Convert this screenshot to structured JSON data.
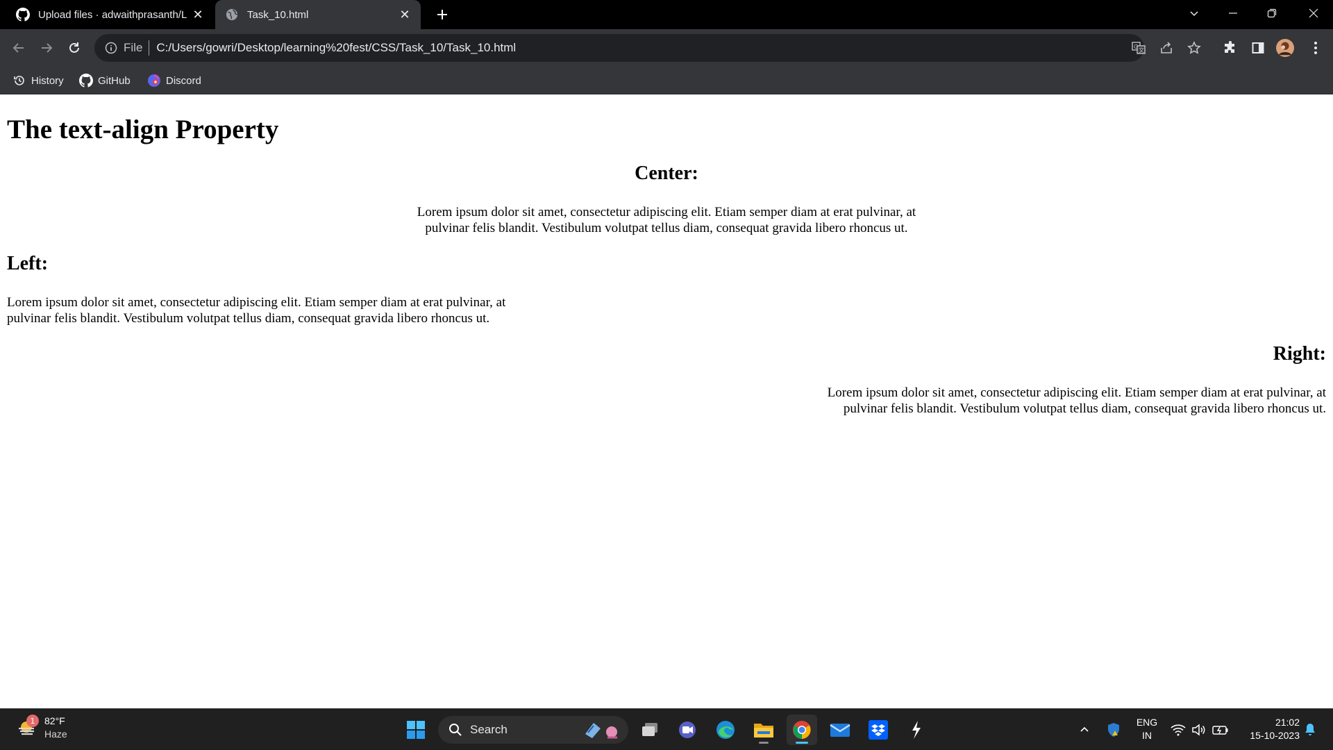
{
  "browser": {
    "tabs": [
      {
        "title": "Upload files · adwaithprasanth/L",
        "favicon": "github-icon",
        "active": false
      },
      {
        "title": "Task_10.html",
        "favicon": "globe-icon",
        "active": true
      }
    ],
    "address_bar": {
      "scheme_label": "File",
      "url": "C:/Users/gowri/Desktop/learning%20fest/CSS/Task_10/Task_10.html"
    },
    "bookmarks": [
      {
        "label": "History",
        "icon": "history-icon"
      },
      {
        "label": "GitHub",
        "icon": "github-icon"
      },
      {
        "label": "Discord",
        "icon": "discord-icon"
      }
    ]
  },
  "page": {
    "heading": "The text-align Property",
    "sections": {
      "center": {
        "title": "Center:",
        "text": "Lorem ipsum dolor sit amet, consectetur adipiscing elit. Etiam semper diam at erat pulvinar, at pulvinar felis blandit. Vestibulum volutpat tellus diam, consequat gravida libero rhoncus ut."
      },
      "left": {
        "title": "Left:",
        "text": "Lorem ipsum dolor sit amet, consectetur adipiscing elit. Etiam semper diam at erat pulvinar, at pulvinar felis blandit. Vestibulum volutpat tellus diam, consequat gravida libero rhoncus ut."
      },
      "right": {
        "title": "Right:",
        "text": "Lorem ipsum dolor sit amet, consectetur adipiscing elit. Etiam semper diam at erat pulvinar, at pulvinar felis blandit. Vestibulum volutpat tellus diam, consequat gravida libero rhoncus ut."
      }
    }
  },
  "taskbar": {
    "weather": {
      "badge": "1",
      "temp": "82°F",
      "condition": "Haze"
    },
    "search_label": "Search",
    "apps": [
      "windows-start-icon",
      "task-view-icon",
      "teams-icon",
      "edge-icon",
      "file-explorer-icon",
      "chrome-icon",
      "mail-icon",
      "dropbox-icon",
      "app-icon"
    ],
    "language": {
      "line1": "ENG",
      "line2": "IN"
    },
    "clock": {
      "time": "21:02",
      "date": "15-10-2023"
    }
  },
  "colors": {
    "tab_strip": "#000000",
    "toolbar": "#35363a",
    "omnibox": "#202124",
    "taskbar": "#202020",
    "accent": "#4cc2ff"
  }
}
